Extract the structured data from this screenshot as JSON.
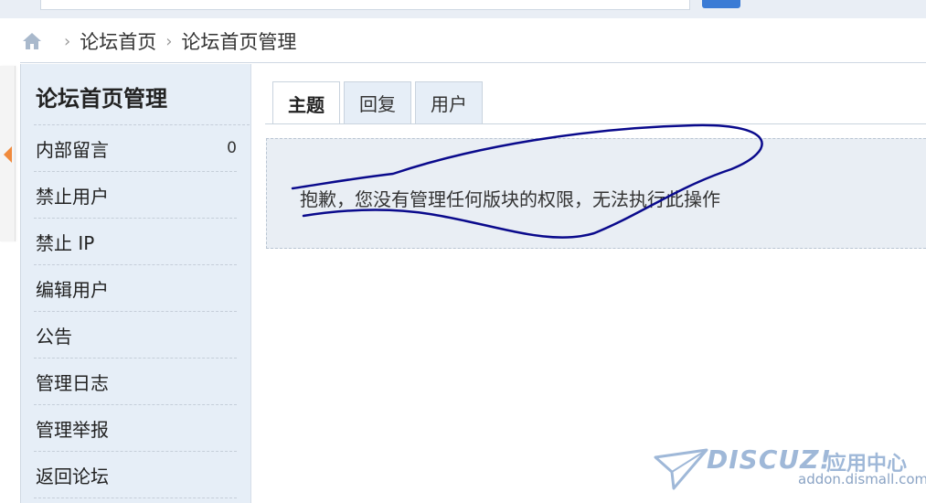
{
  "breadcrumb": {
    "items": [
      "论坛首页",
      "论坛首页管理"
    ]
  },
  "sidebar": {
    "title": "论坛首页管理",
    "items": [
      {
        "label": "内部留言",
        "count": "0"
      },
      {
        "label": "禁止用户"
      },
      {
        "label": "禁止 IP"
      },
      {
        "label": "编辑用户"
      },
      {
        "label": "公告"
      },
      {
        "label": "管理日志"
      },
      {
        "label": "管理举报"
      },
      {
        "label": "返回论坛"
      }
    ]
  },
  "tabs": [
    {
      "label": "主题",
      "active": true
    },
    {
      "label": "回复",
      "active": false
    },
    {
      "label": "用户",
      "active": false
    }
  ],
  "message": "抱歉，您没有管理任何版块的权限，无法执行此操作",
  "watermark": {
    "brand": "DISCUZ!",
    "brand_cn": "应用中心",
    "url": "addon.dismall.com"
  },
  "colors": {
    "accent": "#3a7bd5",
    "sidebar_bg": "#e6eef7",
    "scribble": "#0a0a8c",
    "collapse_arrow": "#f08a3c"
  }
}
